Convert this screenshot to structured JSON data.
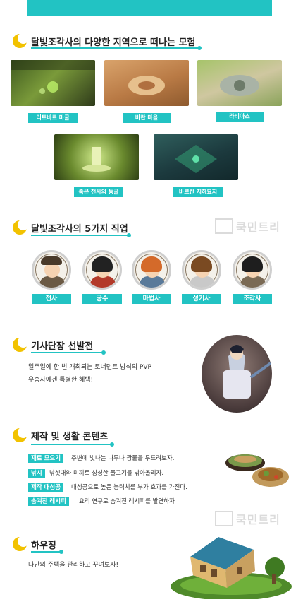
{
  "sections": {
    "regions": {
      "title": "달빛조각사의 다양한 지역으로 떠나는 모험",
      "items": [
        "리트바르 마굴",
        "바란 마을",
        "라비아스",
        "죽은 전사의 동굴",
        "바르칸 지하묘지"
      ]
    },
    "jobs": {
      "title": "달빛조각사의 5가지 직업",
      "items": [
        "전사",
        "궁수",
        "마법사",
        "성기사",
        "조각사"
      ]
    },
    "tournament": {
      "title": "기사단장 선발전",
      "line1": "일주일에 한 번 개최되는 토너먼트 방식의 PVP",
      "line2": "우승자에겐 특별한 혜택!"
    },
    "crafting": {
      "title": "제작 및 생활 콘텐츠",
      "rows": [
        {
          "tag": "재료 모으기",
          "text": "주변에 빛나는 나무나 광물을 두드려보자."
        },
        {
          "tag": "낚시",
          "text": "낚싯대와 미끼로 싱싱한 물고기를 낚아올리자."
        },
        {
          "tag": "제작 대성공",
          "text": "대성공으로 높은 능력치를 부가 효과를 가진다."
        },
        {
          "tag": "숨겨진 레시피",
          "text": "요리 연구로 숨겨진 레시피를 발견하자"
        }
      ]
    },
    "housing": {
      "title": "하우징",
      "text": "나만의 주택을 관리하고 꾸며보자!"
    }
  },
  "watermark": "쿡민트리",
  "colors": {
    "accent": "#22c3c3",
    "moon": "#f2c200"
  }
}
